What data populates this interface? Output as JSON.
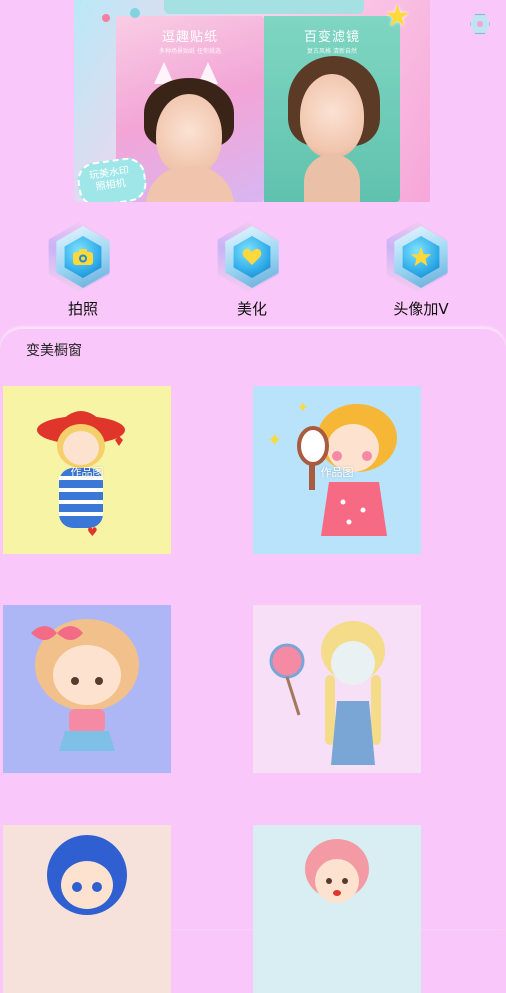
{
  "banner": {
    "left_panel": {
      "title": "逗趣贴纸",
      "subtitle": "多种场景贴纸 任你挑选"
    },
    "right_panel": {
      "title": "百变滤镜",
      "subtitle": "复古风格 清新自然"
    },
    "stamp_text": "玩美水印\n照相机"
  },
  "actions": [
    {
      "label": "拍照",
      "icon": "camera-icon"
    },
    {
      "label": "美化",
      "icon": "heart-icon"
    },
    {
      "label": "头像加V",
      "icon": "star-icon"
    }
  ],
  "section": {
    "title": "变美橱窗",
    "tiles": [
      {
        "caption": "作品图",
        "bg": "#f7f4a6",
        "art": "girl-red-hat"
      },
      {
        "caption": "作品图",
        "bg": "#b9e2fb",
        "art": "girl-mirror"
      },
      {
        "caption": "",
        "bg": "#aeb7f5",
        "art": "girl-pink-bow"
      },
      {
        "caption": "",
        "bg": "#f6dff7",
        "art": "girl-lollipop"
      },
      {
        "caption": "",
        "bg": "#f6e2da",
        "art": "girl-blue-hair"
      },
      {
        "caption": "",
        "bg": "#d8eef3",
        "art": "girl-pink-hair"
      }
    ]
  }
}
